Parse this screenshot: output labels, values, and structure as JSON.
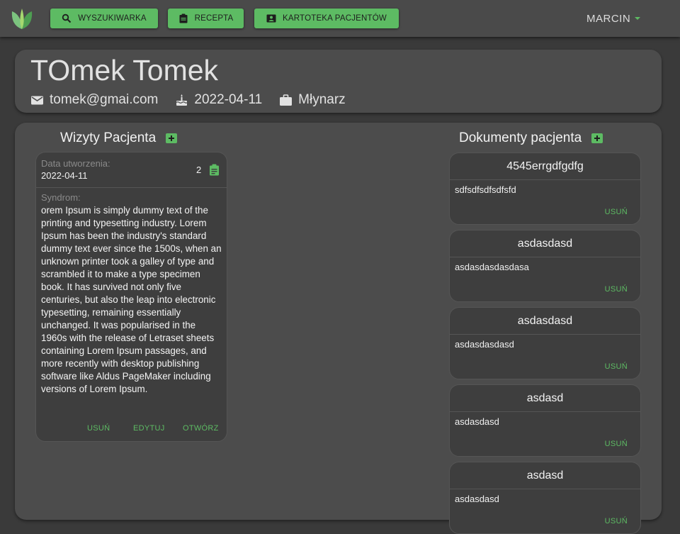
{
  "nav": {
    "search_label": "WYSZUKIWARKA",
    "recipe_label": "RECEPTA",
    "patients_label": "KARTOTEKA PACJENTÓW",
    "user_name": "MARCIN"
  },
  "patient": {
    "name": "TOmek Tomek",
    "email": "tomek@gmai.com",
    "birth_date": "2022-04-11",
    "occupation": "Młynarz"
  },
  "visits": {
    "title": "Wizyty Pacjenta",
    "items": [
      {
        "created_label": "Data utworzenia:",
        "created_date": "2022-04-11",
        "count": "2",
        "syndrome_label": "Syndrom:",
        "syndrome_text": "orem Ipsum is simply dummy text of the printing and typesetting industry. Lorem Ipsum has been the industry's standard dummy text ever since the 1500s, when an unknown printer took a galley of type and scrambled it to make a type specimen book. It has survived not only five centuries, but also the leap into electronic typesetting, remaining essentially unchanged. It was popularised in the 1960s with the release of Letraset sheets containing Lorem Ipsum passages, and more recently with desktop publishing software like Aldus PageMaker including versions of Lorem Ipsum.",
        "delete_label": "USUŃ",
        "edit_label": "EDYTUJ",
        "open_label": "OTWÓRZ"
      }
    ]
  },
  "documents": {
    "title": "Dokumenty pacjenta",
    "items": [
      {
        "title": "4545errgdfgdfg",
        "body": "sdfsdfsdfsdfsfd",
        "delete_label": "USUŃ"
      },
      {
        "title": "asdasdasd",
        "body": "asdasdasdasdasa",
        "delete_label": "USUŃ"
      },
      {
        "title": "asdasdasd",
        "body": "asdasdasdasd",
        "delete_label": "USUŃ"
      },
      {
        "title": "asdasd",
        "body": "asdasdasd",
        "delete_label": "USUŃ"
      },
      {
        "title": "asdasd",
        "body": "asdasdasd",
        "delete_label": "USUŃ"
      }
    ]
  },
  "colors": {
    "accent": "#5dbb63",
    "background": "#3a3a3a",
    "card": "#4c4c4c",
    "inner_card": "#3e3e3e"
  },
  "icons": [
    "leaf-logo",
    "search-icon",
    "clipboard-icon",
    "contact-card-icon",
    "email-icon",
    "cake-icon",
    "briefcase-icon",
    "add-icon"
  ]
}
